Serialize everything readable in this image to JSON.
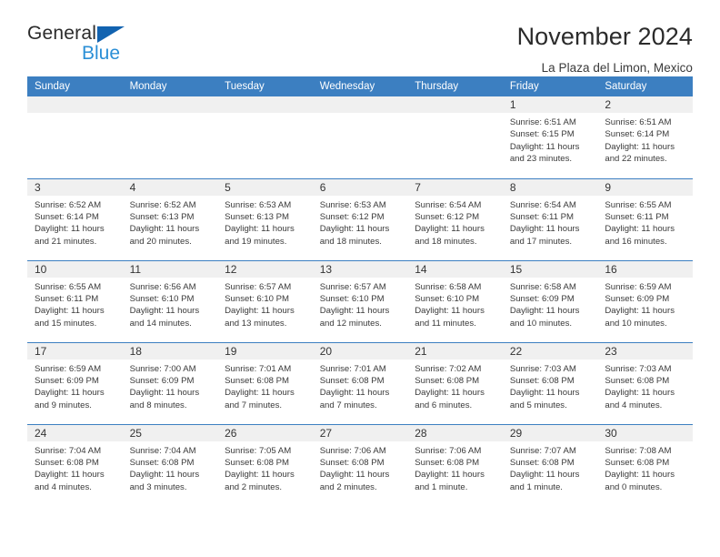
{
  "brand": {
    "name_part1": "General",
    "name_part2": "Blue",
    "accent_color": "#1263b0",
    "accent_color_light": "#2b8fd6"
  },
  "header": {
    "title": "November 2024",
    "subtitle": "La Plaza del Limon, Mexico"
  },
  "theme": {
    "header_row_bg": "#3c7fc1",
    "daynum_band_bg": "#f0f0f0",
    "border_color": "#3c7fc1"
  },
  "weekdays": [
    "Sunday",
    "Monday",
    "Tuesday",
    "Wednesday",
    "Thursday",
    "Friday",
    "Saturday"
  ],
  "weeks": [
    [
      {
        "day": "",
        "empty": true
      },
      {
        "day": "",
        "empty": true
      },
      {
        "day": "",
        "empty": true
      },
      {
        "day": "",
        "empty": true
      },
      {
        "day": "",
        "empty": true
      },
      {
        "day": "1",
        "sunrise": "Sunrise: 6:51 AM",
        "sunset": "Sunset: 6:15 PM",
        "daylight": "Daylight: 11 hours and 23 minutes."
      },
      {
        "day": "2",
        "sunrise": "Sunrise: 6:51 AM",
        "sunset": "Sunset: 6:14 PM",
        "daylight": "Daylight: 11 hours and 22 minutes."
      }
    ],
    [
      {
        "day": "3",
        "sunrise": "Sunrise: 6:52 AM",
        "sunset": "Sunset: 6:14 PM",
        "daylight": "Daylight: 11 hours and 21 minutes."
      },
      {
        "day": "4",
        "sunrise": "Sunrise: 6:52 AM",
        "sunset": "Sunset: 6:13 PM",
        "daylight": "Daylight: 11 hours and 20 minutes."
      },
      {
        "day": "5",
        "sunrise": "Sunrise: 6:53 AM",
        "sunset": "Sunset: 6:13 PM",
        "daylight": "Daylight: 11 hours and 19 minutes."
      },
      {
        "day": "6",
        "sunrise": "Sunrise: 6:53 AM",
        "sunset": "Sunset: 6:12 PM",
        "daylight": "Daylight: 11 hours and 18 minutes."
      },
      {
        "day": "7",
        "sunrise": "Sunrise: 6:54 AM",
        "sunset": "Sunset: 6:12 PM",
        "daylight": "Daylight: 11 hours and 18 minutes."
      },
      {
        "day": "8",
        "sunrise": "Sunrise: 6:54 AM",
        "sunset": "Sunset: 6:11 PM",
        "daylight": "Daylight: 11 hours and 17 minutes."
      },
      {
        "day": "9",
        "sunrise": "Sunrise: 6:55 AM",
        "sunset": "Sunset: 6:11 PM",
        "daylight": "Daylight: 11 hours and 16 minutes."
      }
    ],
    [
      {
        "day": "10",
        "sunrise": "Sunrise: 6:55 AM",
        "sunset": "Sunset: 6:11 PM",
        "daylight": "Daylight: 11 hours and 15 minutes."
      },
      {
        "day": "11",
        "sunrise": "Sunrise: 6:56 AM",
        "sunset": "Sunset: 6:10 PM",
        "daylight": "Daylight: 11 hours and 14 minutes."
      },
      {
        "day": "12",
        "sunrise": "Sunrise: 6:57 AM",
        "sunset": "Sunset: 6:10 PM",
        "daylight": "Daylight: 11 hours and 13 minutes."
      },
      {
        "day": "13",
        "sunrise": "Sunrise: 6:57 AM",
        "sunset": "Sunset: 6:10 PM",
        "daylight": "Daylight: 11 hours and 12 minutes."
      },
      {
        "day": "14",
        "sunrise": "Sunrise: 6:58 AM",
        "sunset": "Sunset: 6:10 PM",
        "daylight": "Daylight: 11 hours and 11 minutes."
      },
      {
        "day": "15",
        "sunrise": "Sunrise: 6:58 AM",
        "sunset": "Sunset: 6:09 PM",
        "daylight": "Daylight: 11 hours and 10 minutes."
      },
      {
        "day": "16",
        "sunrise": "Sunrise: 6:59 AM",
        "sunset": "Sunset: 6:09 PM",
        "daylight": "Daylight: 11 hours and 10 minutes."
      }
    ],
    [
      {
        "day": "17",
        "sunrise": "Sunrise: 6:59 AM",
        "sunset": "Sunset: 6:09 PM",
        "daylight": "Daylight: 11 hours and 9 minutes."
      },
      {
        "day": "18",
        "sunrise": "Sunrise: 7:00 AM",
        "sunset": "Sunset: 6:09 PM",
        "daylight": "Daylight: 11 hours and 8 minutes."
      },
      {
        "day": "19",
        "sunrise": "Sunrise: 7:01 AM",
        "sunset": "Sunset: 6:08 PM",
        "daylight": "Daylight: 11 hours and 7 minutes."
      },
      {
        "day": "20",
        "sunrise": "Sunrise: 7:01 AM",
        "sunset": "Sunset: 6:08 PM",
        "daylight": "Daylight: 11 hours and 7 minutes."
      },
      {
        "day": "21",
        "sunrise": "Sunrise: 7:02 AM",
        "sunset": "Sunset: 6:08 PM",
        "daylight": "Daylight: 11 hours and 6 minutes."
      },
      {
        "day": "22",
        "sunrise": "Sunrise: 7:03 AM",
        "sunset": "Sunset: 6:08 PM",
        "daylight": "Daylight: 11 hours and 5 minutes."
      },
      {
        "day": "23",
        "sunrise": "Sunrise: 7:03 AM",
        "sunset": "Sunset: 6:08 PM",
        "daylight": "Daylight: 11 hours and 4 minutes."
      }
    ],
    [
      {
        "day": "24",
        "sunrise": "Sunrise: 7:04 AM",
        "sunset": "Sunset: 6:08 PM",
        "daylight": "Daylight: 11 hours and 4 minutes."
      },
      {
        "day": "25",
        "sunrise": "Sunrise: 7:04 AM",
        "sunset": "Sunset: 6:08 PM",
        "daylight": "Daylight: 11 hours and 3 minutes."
      },
      {
        "day": "26",
        "sunrise": "Sunrise: 7:05 AM",
        "sunset": "Sunset: 6:08 PM",
        "daylight": "Daylight: 11 hours and 2 minutes."
      },
      {
        "day": "27",
        "sunrise": "Sunrise: 7:06 AM",
        "sunset": "Sunset: 6:08 PM",
        "daylight": "Daylight: 11 hours and 2 minutes."
      },
      {
        "day": "28",
        "sunrise": "Sunrise: 7:06 AM",
        "sunset": "Sunset: 6:08 PM",
        "daylight": "Daylight: 11 hours and 1 minute."
      },
      {
        "day": "29",
        "sunrise": "Sunrise: 7:07 AM",
        "sunset": "Sunset: 6:08 PM",
        "daylight": "Daylight: 11 hours and 1 minute."
      },
      {
        "day": "30",
        "sunrise": "Sunrise: 7:08 AM",
        "sunset": "Sunset: 6:08 PM",
        "daylight": "Daylight: 11 hours and 0 minutes."
      }
    ]
  ]
}
